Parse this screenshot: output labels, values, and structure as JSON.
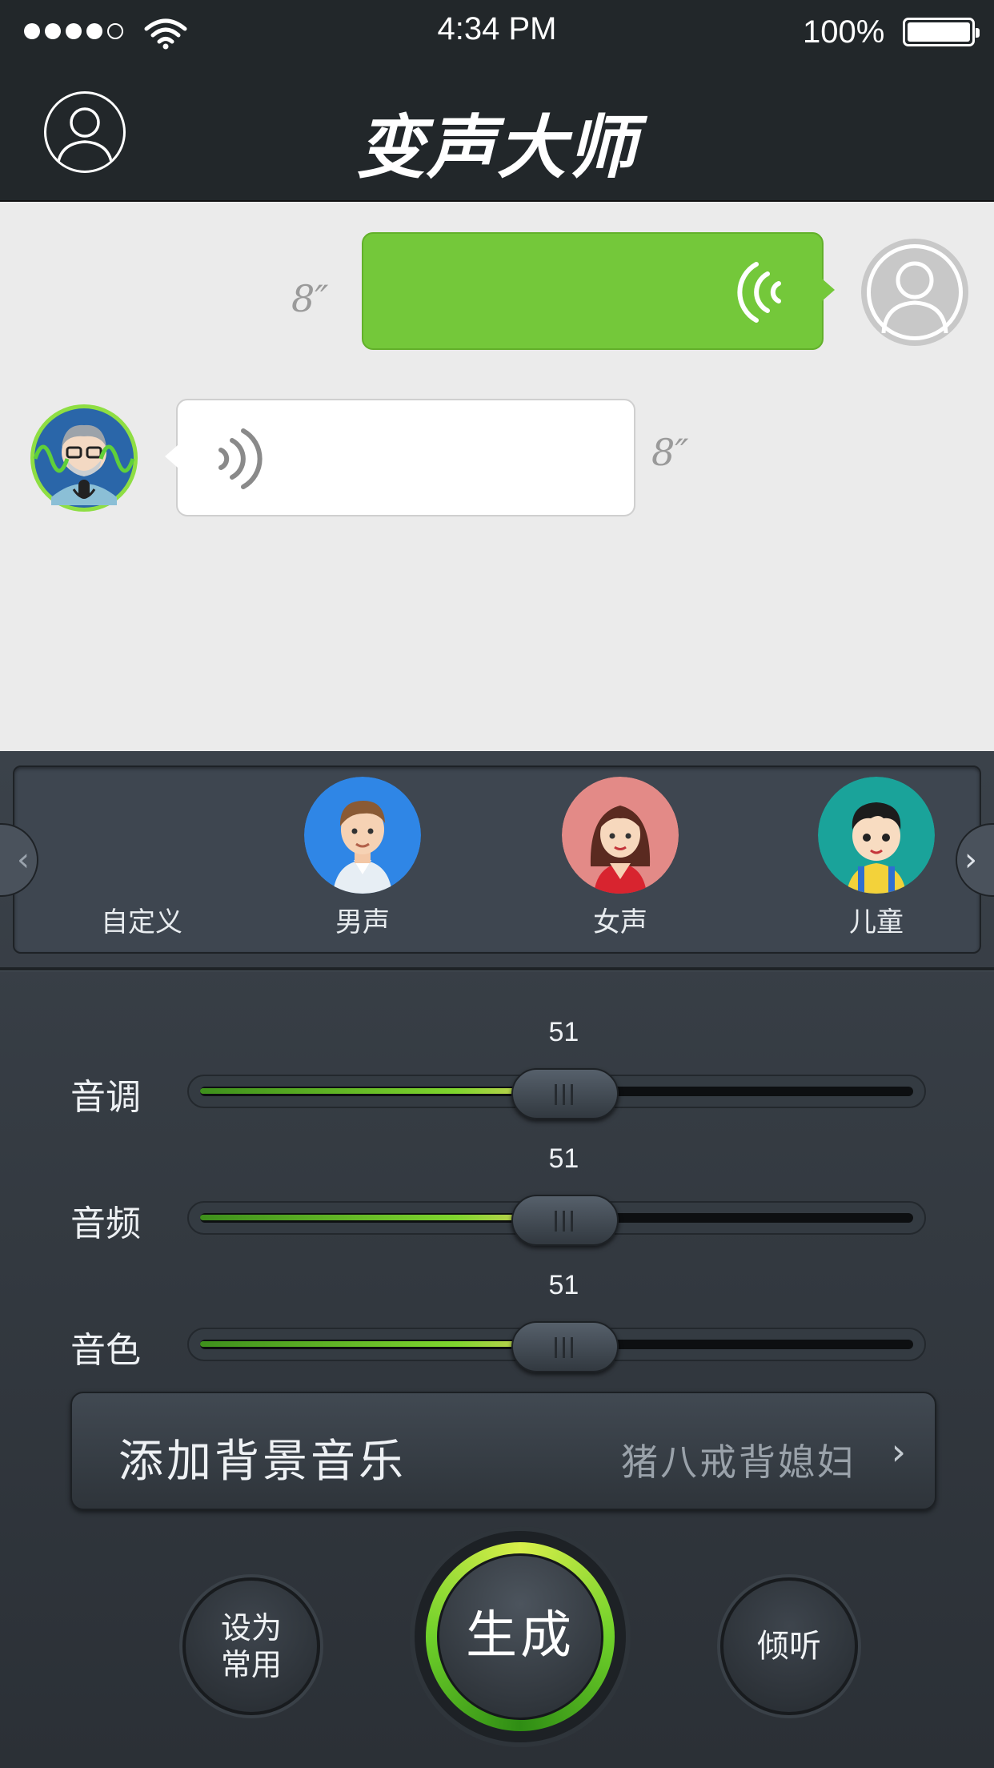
{
  "status_bar": {
    "time": "4:34 PM",
    "battery": "100%"
  },
  "header": {
    "title": "变声大师"
  },
  "chat": {
    "outgoing": {
      "duration": "8″"
    },
    "incoming": {
      "duration": "8″"
    }
  },
  "voices": [
    {
      "label": "自定义"
    },
    {
      "label": "男声"
    },
    {
      "label": "女声"
    },
    {
      "label": "儿童"
    }
  ],
  "sliders": [
    {
      "label": "音调",
      "value": "51",
      "fraction": 0.51
    },
    {
      "label": "音频",
      "value": "51",
      "fraction": 0.51
    },
    {
      "label": "音色",
      "value": "51",
      "fraction": 0.51
    }
  ],
  "background_music": {
    "label": "添加背景音乐",
    "selected": "猪八戒背媳妇"
  },
  "actions": {
    "favorite_line1": "设为",
    "favorite_line2": "常用",
    "generate": "生成",
    "listen": "倾听"
  },
  "colors": {
    "accent_green": "#74c83a",
    "header_bg": "#22272a"
  }
}
